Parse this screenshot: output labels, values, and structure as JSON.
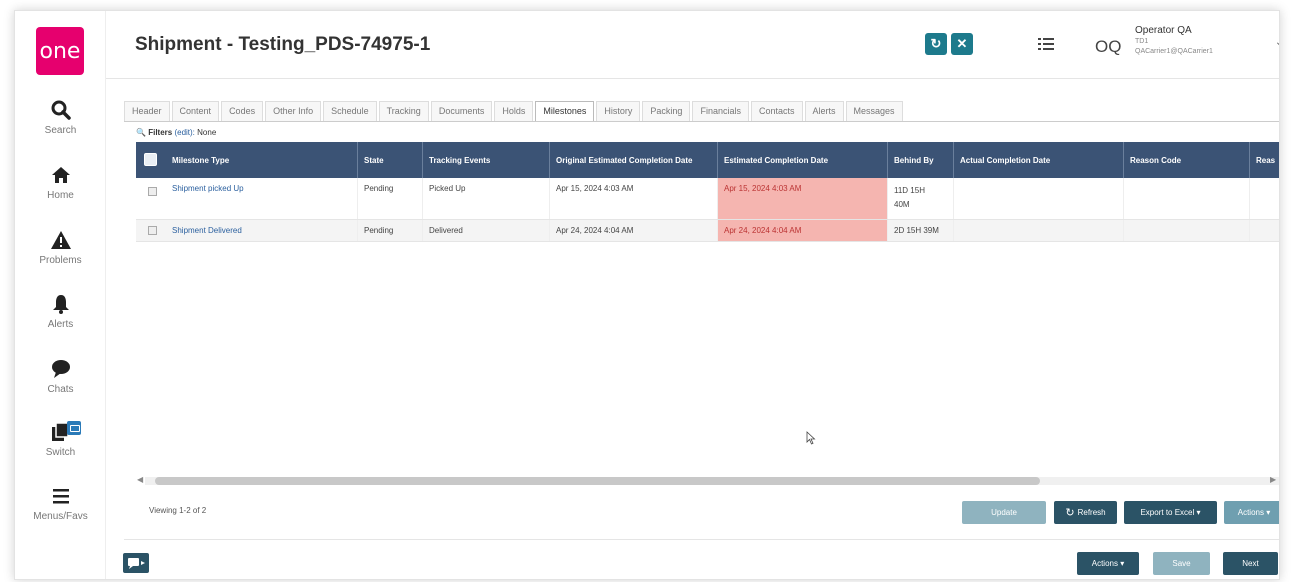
{
  "app": {
    "logo_text": "one",
    "brand_color": "#e6006e",
    "accent_color": "#1d7a8c"
  },
  "sidebar": {
    "items": [
      {
        "label": "Search",
        "icon": "search-icon"
      },
      {
        "label": "Home",
        "icon": "home-icon"
      },
      {
        "label": "Problems",
        "icon": "warning-icon"
      },
      {
        "label": "Alerts",
        "icon": "bell-icon"
      },
      {
        "label": "Chats",
        "icon": "chat-icon"
      },
      {
        "label": "Switch",
        "icon": "switch-icon"
      },
      {
        "label": "Menus/Favs",
        "icon": "menu-icon"
      }
    ]
  },
  "header": {
    "title": "Shipment - Testing_PDS-74975-1",
    "refresh_icon": "↻",
    "close_icon": "✕",
    "avatar": "OQ",
    "user_name": "Operator QA",
    "user_org": "TD1",
    "user_role": "QACarrier1@QACarrier1"
  },
  "tabs": [
    "Header",
    "Content",
    "Codes",
    "Other Info",
    "Schedule",
    "Tracking",
    "Documents",
    "Holds",
    "Milestones",
    "History",
    "Packing",
    "Financials",
    "Contacts",
    "Alerts",
    "Messages"
  ],
  "active_tab": "Milestones",
  "filters": {
    "label": "Filters",
    "edit": "(edit):",
    "value": "None"
  },
  "grid": {
    "columns": [
      "Milestone Type",
      "State",
      "Tracking Events",
      "Original Estimated Completion Date",
      "Estimated Completion Date",
      "Behind By",
      "Actual Completion Date",
      "Reason Code",
      "Reas"
    ],
    "rows": [
      {
        "milestone_type": "Shipment picked Up",
        "state": "Pending",
        "tracking_events": "Picked Up",
        "original_date": "Apr 15, 2024 4:03 AM",
        "estimated_date": "Apr 15, 2024 4:03 AM",
        "behind_by_1": "11D 15H",
        "behind_by_2": "40M",
        "actual_date": "",
        "reason_code": ""
      },
      {
        "milestone_type": "Shipment Delivered",
        "state": "Pending",
        "tracking_events": "Delivered",
        "original_date": "Apr 24, 2024 4:04 AM",
        "estimated_date": "Apr 24, 2024 4:04 AM",
        "behind_by_1": "2D 15H 39M",
        "behind_by_2": "",
        "actual_date": "",
        "reason_code": ""
      }
    ]
  },
  "footer": {
    "viewing": "Viewing 1-2 of 2",
    "update": "Update",
    "refresh": "Refresh",
    "export": "Export to Excel ▾",
    "actions_grid": "Actions ▾",
    "actions": "Actions ▾",
    "save": "Save",
    "next": "Next"
  }
}
